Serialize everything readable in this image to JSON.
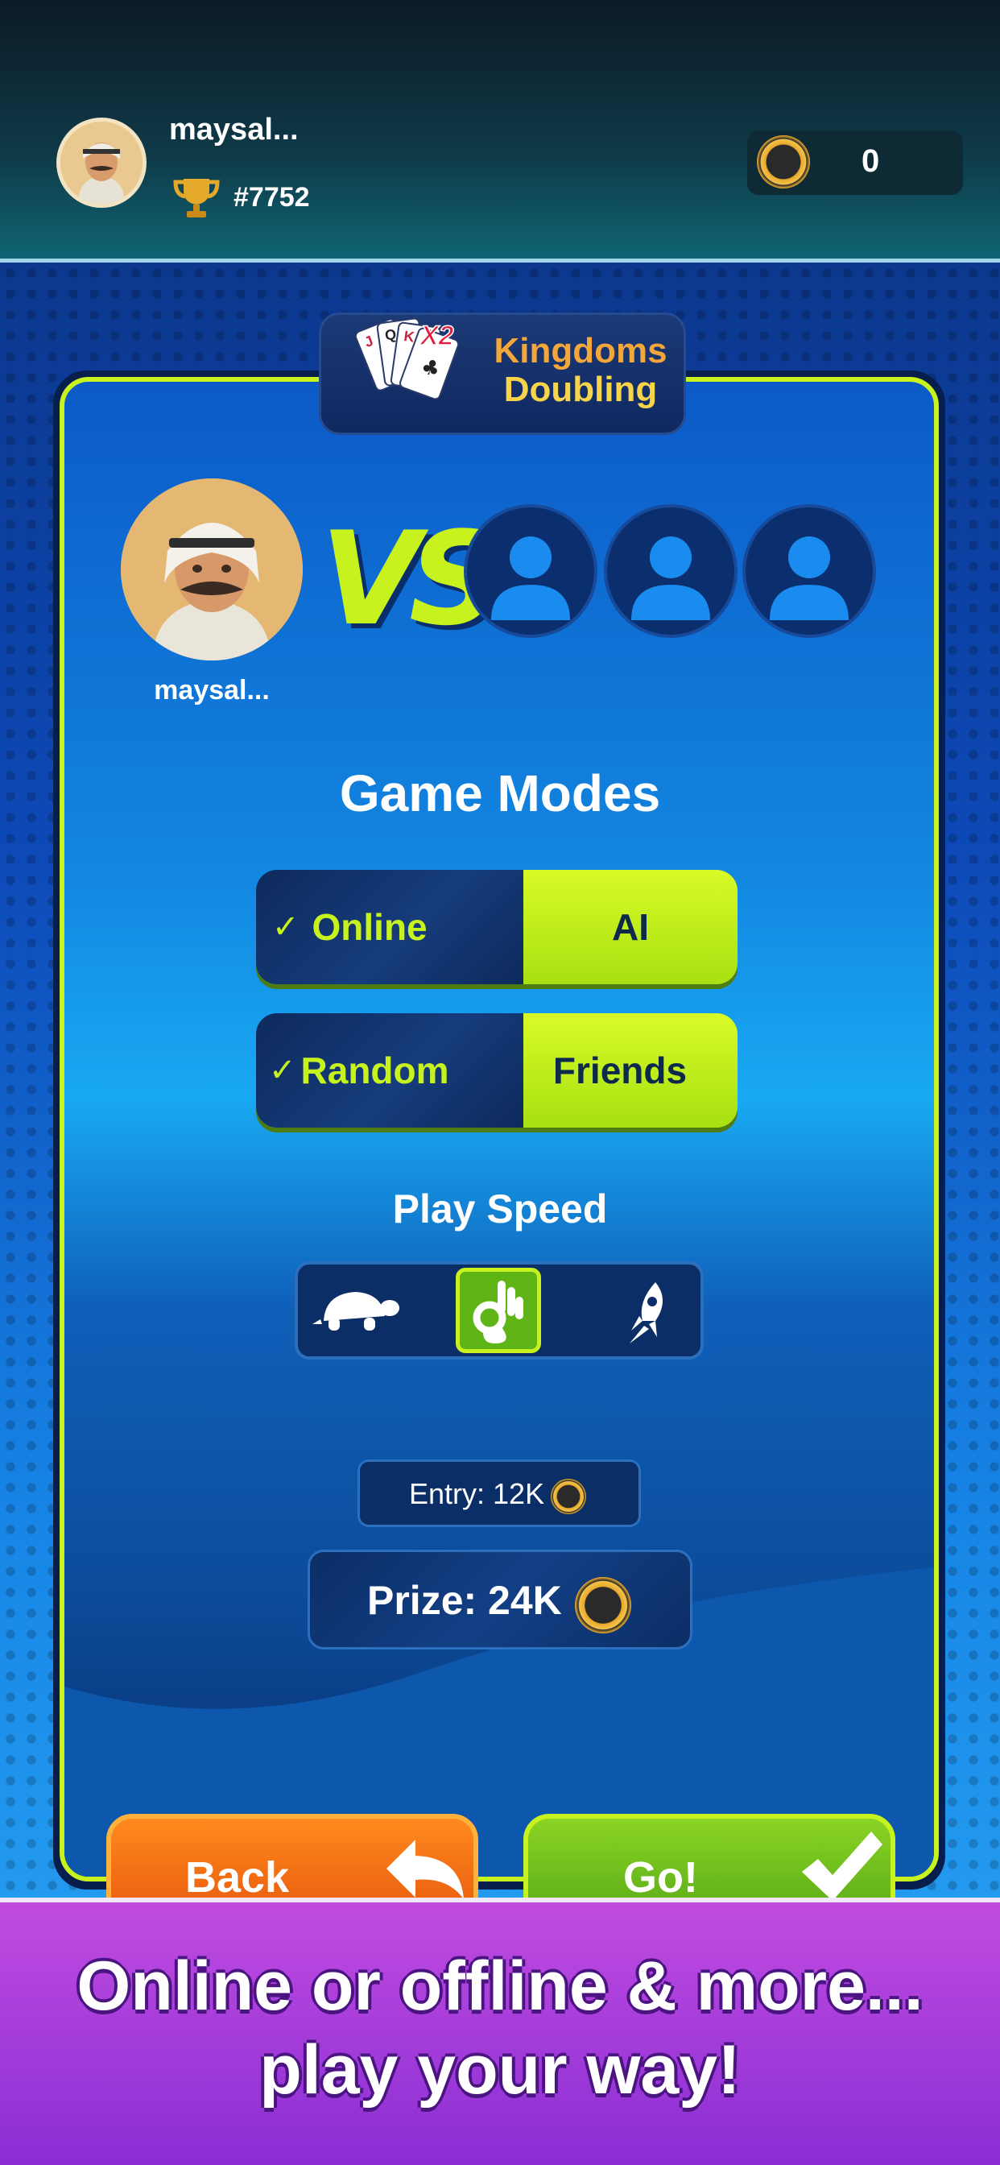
{
  "header": {
    "username": "maysal...",
    "rank": "#7752",
    "coins": "0"
  },
  "game": {
    "title_line1": "Kingdoms",
    "title_line2": "Doubling",
    "cards_multiplier": "X2",
    "player_name": "maysal...",
    "vs": "VS"
  },
  "modes": {
    "heading": "Game Modes",
    "connection": {
      "selected": "Online",
      "other": "AI"
    },
    "opponents": {
      "selected": "Random",
      "other": "Friends"
    }
  },
  "speed": {
    "heading": "Play Speed",
    "options": [
      "slow",
      "normal",
      "fast"
    ],
    "selected": "normal"
  },
  "stakes": {
    "entry": "Entry: 12K",
    "prize": "Prize: 24K"
  },
  "buttons": {
    "back": "Back",
    "go": "Go!"
  },
  "promo": {
    "line1": "Online or offline & more...",
    "line2": "play your way!"
  },
  "colors": {
    "accent_lime": "#c8f21e",
    "promo_purple": "#a63bdc",
    "back_orange": "#f26a14",
    "go_green": "#6cbc1c"
  }
}
